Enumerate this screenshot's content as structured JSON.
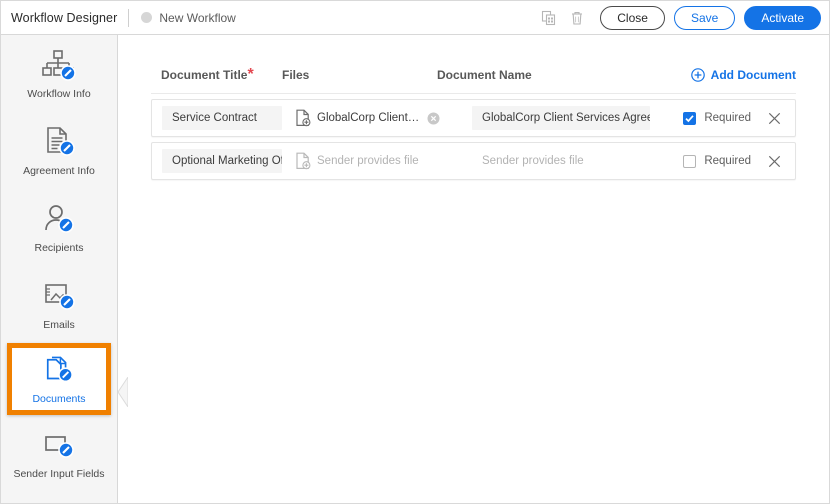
{
  "header": {
    "app_title": "Workflow Designer",
    "workflow_name": "New Workflow",
    "copy_icon": "duplicate-icon",
    "trash_icon": "trash-icon",
    "close_label": "Close",
    "save_label": "Save",
    "activate_label": "Activate",
    "accent_blue": "#1473e6"
  },
  "sidebar": {
    "items": [
      {
        "label": "Workflow Info",
        "icon": "workflow-info-icon",
        "active": false
      },
      {
        "label": "Agreement Info",
        "icon": "agreement-info-icon",
        "active": false
      },
      {
        "label": "Recipients",
        "icon": "recipients-icon",
        "active": false
      },
      {
        "label": "Emails",
        "icon": "emails-icon",
        "active": false
      },
      {
        "label": "Documents",
        "icon": "documents-icon",
        "active": true
      },
      {
        "label": "Sender Input Fields",
        "icon": "sender-input-fields-icon",
        "active": false
      }
    ],
    "highlight_color": "#f08000",
    "collapse_icon": "chevron-left-icon"
  },
  "main": {
    "columns": {
      "title": "Document Title",
      "title_required_marker": "*",
      "files": "Files",
      "name": "Document Name"
    },
    "add_document_label": "Add Document",
    "add_document_icon": "plus-circle-icon",
    "required_label": "Required",
    "rows": [
      {
        "title": "Service Contract",
        "file_icon": "document-add-icon",
        "file_name": "GlobalCorp Client Servic...",
        "file_is_placeholder": false,
        "clear_file_icon": "clear-circle-icon",
        "document_name": "GlobalCorp Client Services Agreement",
        "name_is_placeholder": false,
        "required": true,
        "remove_icon": "close-icon"
      },
      {
        "title": "Optional Marketing Offer",
        "file_icon": "document-add-icon",
        "file_name": "Sender provides file",
        "file_is_placeholder": true,
        "clear_file_icon": null,
        "document_name": "Sender provides file",
        "name_is_placeholder": true,
        "required": false,
        "remove_icon": "close-icon"
      }
    ]
  }
}
